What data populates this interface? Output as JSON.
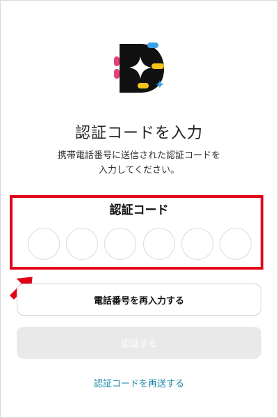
{
  "title": "認証コードを入力",
  "subtitle": [
    "携帯電話番号に送信された認証コードを",
    "入力してください。"
  ],
  "code": {
    "label": "認証コード",
    "digits": [
      "",
      "",
      "",
      "",
      "",
      ""
    ]
  },
  "buttons": {
    "reenter_phone": "電話番号を再入力する",
    "verify": "認証する"
  },
  "resend_link": "認証コードを再送する",
  "icons": {
    "logo": "app-logo-icon",
    "annotation_arrow": "arrow-up-right-icon"
  },
  "colors": {
    "highlight": "#e0001a",
    "link": "#1a86a8",
    "logo_dark": "#111111",
    "logo_pink": "#e6407a",
    "logo_yellow": "#f6c21c",
    "logo_blue": "#3aa0e6"
  }
}
